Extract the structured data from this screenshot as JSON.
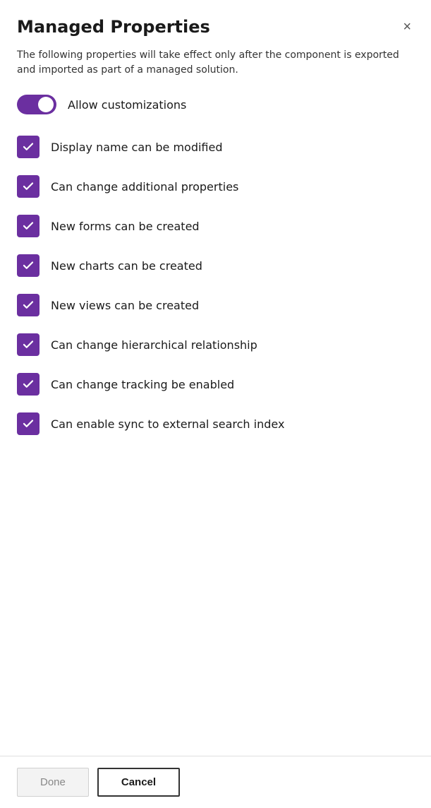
{
  "dialog": {
    "title": "Managed Properties",
    "description": "The following properties will take effect only after the component is exported and imported as part of a managed solution.",
    "close_label": "×"
  },
  "toggle": {
    "label": "Allow customizations",
    "checked": true
  },
  "checkboxes": [
    {
      "label": "Display name can be modified",
      "checked": true
    },
    {
      "label": "Can change additional properties",
      "checked": true
    },
    {
      "label": "New forms can be created",
      "checked": true
    },
    {
      "label": "New charts can be created",
      "checked": true
    },
    {
      "label": "New views can be created",
      "checked": true
    },
    {
      "label": "Can change hierarchical relationship",
      "checked": true
    },
    {
      "label": "Can change tracking be enabled",
      "checked": true
    },
    {
      "label": "Can enable sync to external search index",
      "checked": true
    }
  ],
  "footer": {
    "done_label": "Done",
    "cancel_label": "Cancel"
  }
}
